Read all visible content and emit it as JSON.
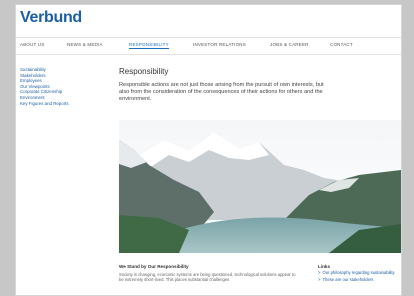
{
  "header": {
    "logo": "Verbund"
  },
  "nav": {
    "items": [
      {
        "label": "About us"
      },
      {
        "label": "News & Media"
      },
      {
        "label": "Responsibility"
      },
      {
        "label": "Investor Relations"
      },
      {
        "label": "Jobs & Career"
      },
      {
        "label": "Contact"
      }
    ],
    "active_index": 2
  },
  "sidebar": {
    "items": [
      {
        "label": "Sustainability"
      },
      {
        "label": "Stakeholders"
      },
      {
        "label": "Employees"
      },
      {
        "label": "Our Viewpoints"
      },
      {
        "label": "Corporate Citizenship"
      },
      {
        "label": "Environment"
      },
      {
        "label": "Key Figures and Reports"
      }
    ]
  },
  "main": {
    "title": "Responsibility",
    "intro": "Responsible actions are not just those arising from the pursuit of own interests, but also from the consideration of the consequences of their actions for others and the environment."
  },
  "lower": {
    "section_title": "We Stand by Our Responsibility",
    "body": "Society is changing, economic systems are being questioned, technological solutions appear to be extremely short-lived. This places substantial challenges"
  },
  "links": {
    "title": "Links",
    "items": [
      {
        "label": "Our philosophy regarding sustainability"
      },
      {
        "label": "These are our stakeholders"
      }
    ]
  },
  "colors": {
    "brand": "#1b5fa8",
    "background": "#c7c7c7"
  }
}
